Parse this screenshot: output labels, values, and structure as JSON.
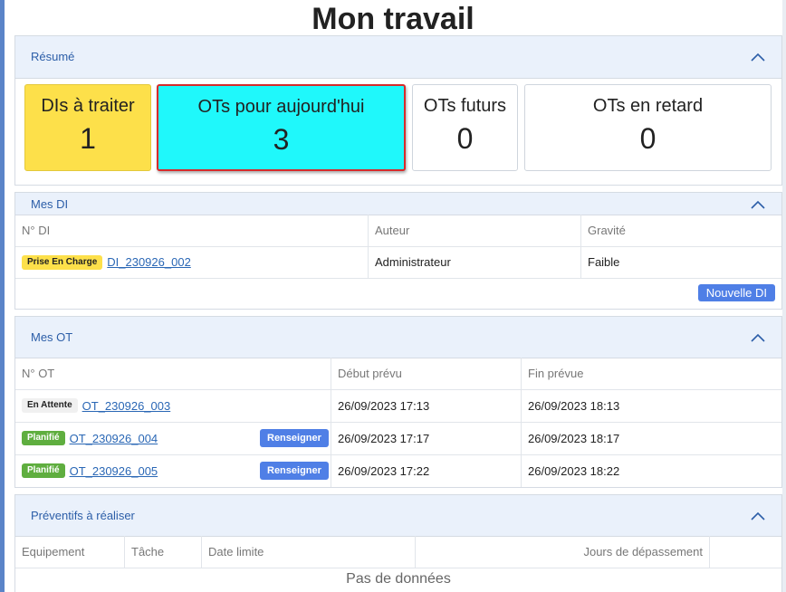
{
  "page": {
    "title": "Mon travail"
  },
  "resume": {
    "title": "Résumé",
    "cards": [
      {
        "label": "DIs à traiter",
        "value": "1",
        "color": "#fde04a"
      },
      {
        "label": "OTs pour aujourd'hui",
        "value": "3",
        "color": "#1ff8fb"
      },
      {
        "label": "OTs futurs",
        "value": "0"
      },
      {
        "label": "OTs en retard",
        "value": "0"
      }
    ]
  },
  "mes_di": {
    "title": "Mes DI",
    "columns": [
      "N° DI",
      "Auteur",
      "Gravité"
    ],
    "rows": [
      {
        "status": "Prise En Charge",
        "id": "DI_230926_002",
        "auteur": "Administrateur",
        "gravite": "Faible"
      }
    ],
    "new_button": "Nouvelle DI"
  },
  "mes_ot": {
    "title": "Mes OT",
    "columns": [
      "N° OT",
      "Début prévu",
      "Fin prévue"
    ],
    "rows": [
      {
        "status": "En Attente",
        "id": "OT_230926_003",
        "debut": "26/09/2023 17:13",
        "fin": "26/09/2023 18:13",
        "action": ""
      },
      {
        "status": "Planifié",
        "id": "OT_230926_004",
        "debut": "26/09/2023 17:17",
        "fin": "26/09/2023 18:17",
        "action": "Renseigner"
      },
      {
        "status": "Planifié",
        "id": "OT_230926_005",
        "debut": "26/09/2023 17:22",
        "fin": "26/09/2023 18:22",
        "action": "Renseigner"
      }
    ]
  },
  "preventifs": {
    "title": "Préventifs à réaliser",
    "columns": [
      "Equipement",
      "Tâche",
      "Date limite",
      "Jours de dépassement"
    ],
    "empty": "Pas de données"
  },
  "colors": {
    "accent": "#4f7fe6",
    "header_bg": "#eaf1fb",
    "highlight_border": "#d62b2b"
  }
}
